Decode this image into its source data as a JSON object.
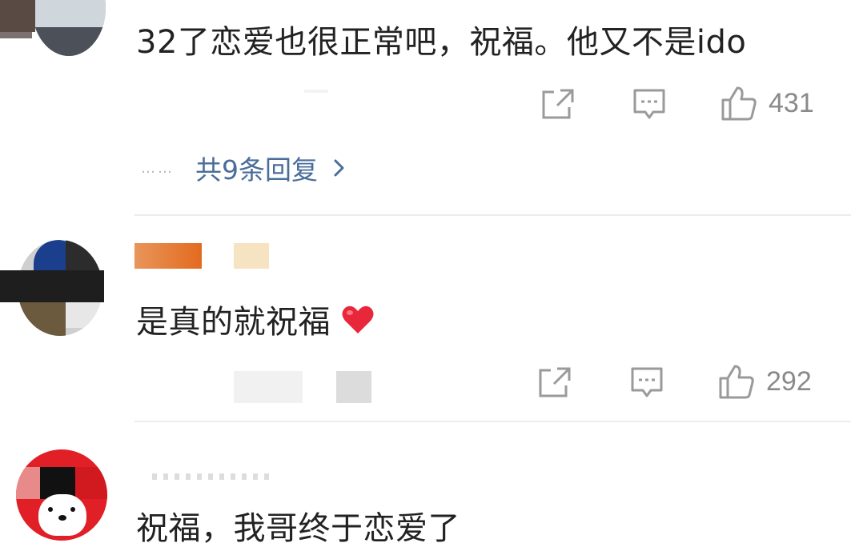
{
  "comments": [
    {
      "text": "32了恋爱也很正常吧，祝福。他又不是ido",
      "likes": "431",
      "replies_link": "共9条回复",
      "replies_dots": "……"
    },
    {
      "text": "是真的就祝福",
      "likes": "292"
    },
    {
      "text": "祝福，我哥终于恋爱了"
    }
  ],
  "icons": {
    "share": "share-external-icon",
    "comment": "comment-bubble-icon",
    "like": "thumbs-up-icon",
    "heart": "red-heart-emoji",
    "chevron": "chevron-right-icon"
  },
  "colors": {
    "link": "#4a6d9a",
    "icon": "#9a9a9a",
    "heart": "#e8283a",
    "text": "#222222"
  }
}
